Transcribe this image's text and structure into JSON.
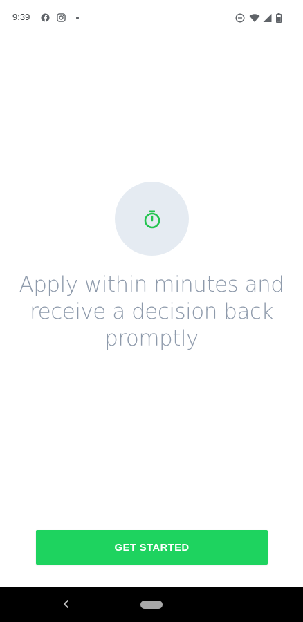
{
  "status_bar": {
    "time": "9:39",
    "left_icons": [
      "facebook-icon",
      "instagram-icon",
      "notification-dot"
    ],
    "right_icons": [
      "do-not-disturb-icon",
      "wifi-icon",
      "cellular-signal-icon",
      "battery-icon"
    ]
  },
  "main": {
    "icon": "stopwatch-icon",
    "headline": "Apply within minutes and receive a decision back promptly"
  },
  "cta": {
    "label": "GET STARTED"
  },
  "nav_bar": {
    "icons": [
      "back-icon",
      "home-pill-icon"
    ]
  },
  "colors": {
    "accent": "#1ed35f",
    "icon_green": "#22c44f",
    "circle_bg": "#e5ebf2",
    "headline_text": "#8e9aab",
    "nav_bg": "#000000"
  }
}
